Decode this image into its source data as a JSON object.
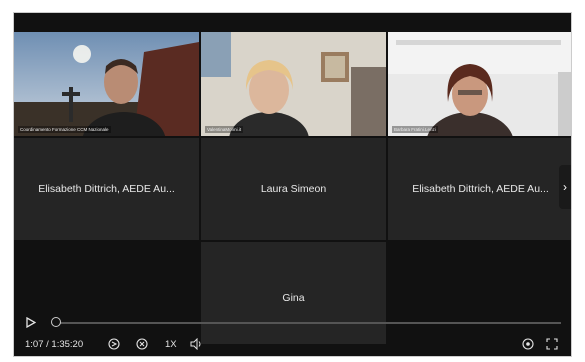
{
  "video_tiles": [
    {
      "caption": "Coordinamento Formazione CCM Nazionale"
    },
    {
      "caption": "ValentinaMorini.it"
    },
    {
      "caption": "Barbara Fratini.Lenzi"
    }
  ],
  "name_tiles": [
    {
      "label": "Elisabeth Dittrich, AEDE Au..."
    },
    {
      "label": "Laura Simeon"
    },
    {
      "label": "Elisabeth Dittrich, AEDE Au..."
    },
    {
      "label": "Gina"
    }
  ],
  "player": {
    "time": "1:07 / 1:35:20",
    "speed": "1X",
    "progress": 0.012
  },
  "icons": [
    "play-icon",
    "rewind-icon",
    "forward-icon",
    "volume-icon",
    "settings-icon",
    "fullscreen-icon",
    "chevron-right-icon"
  ]
}
